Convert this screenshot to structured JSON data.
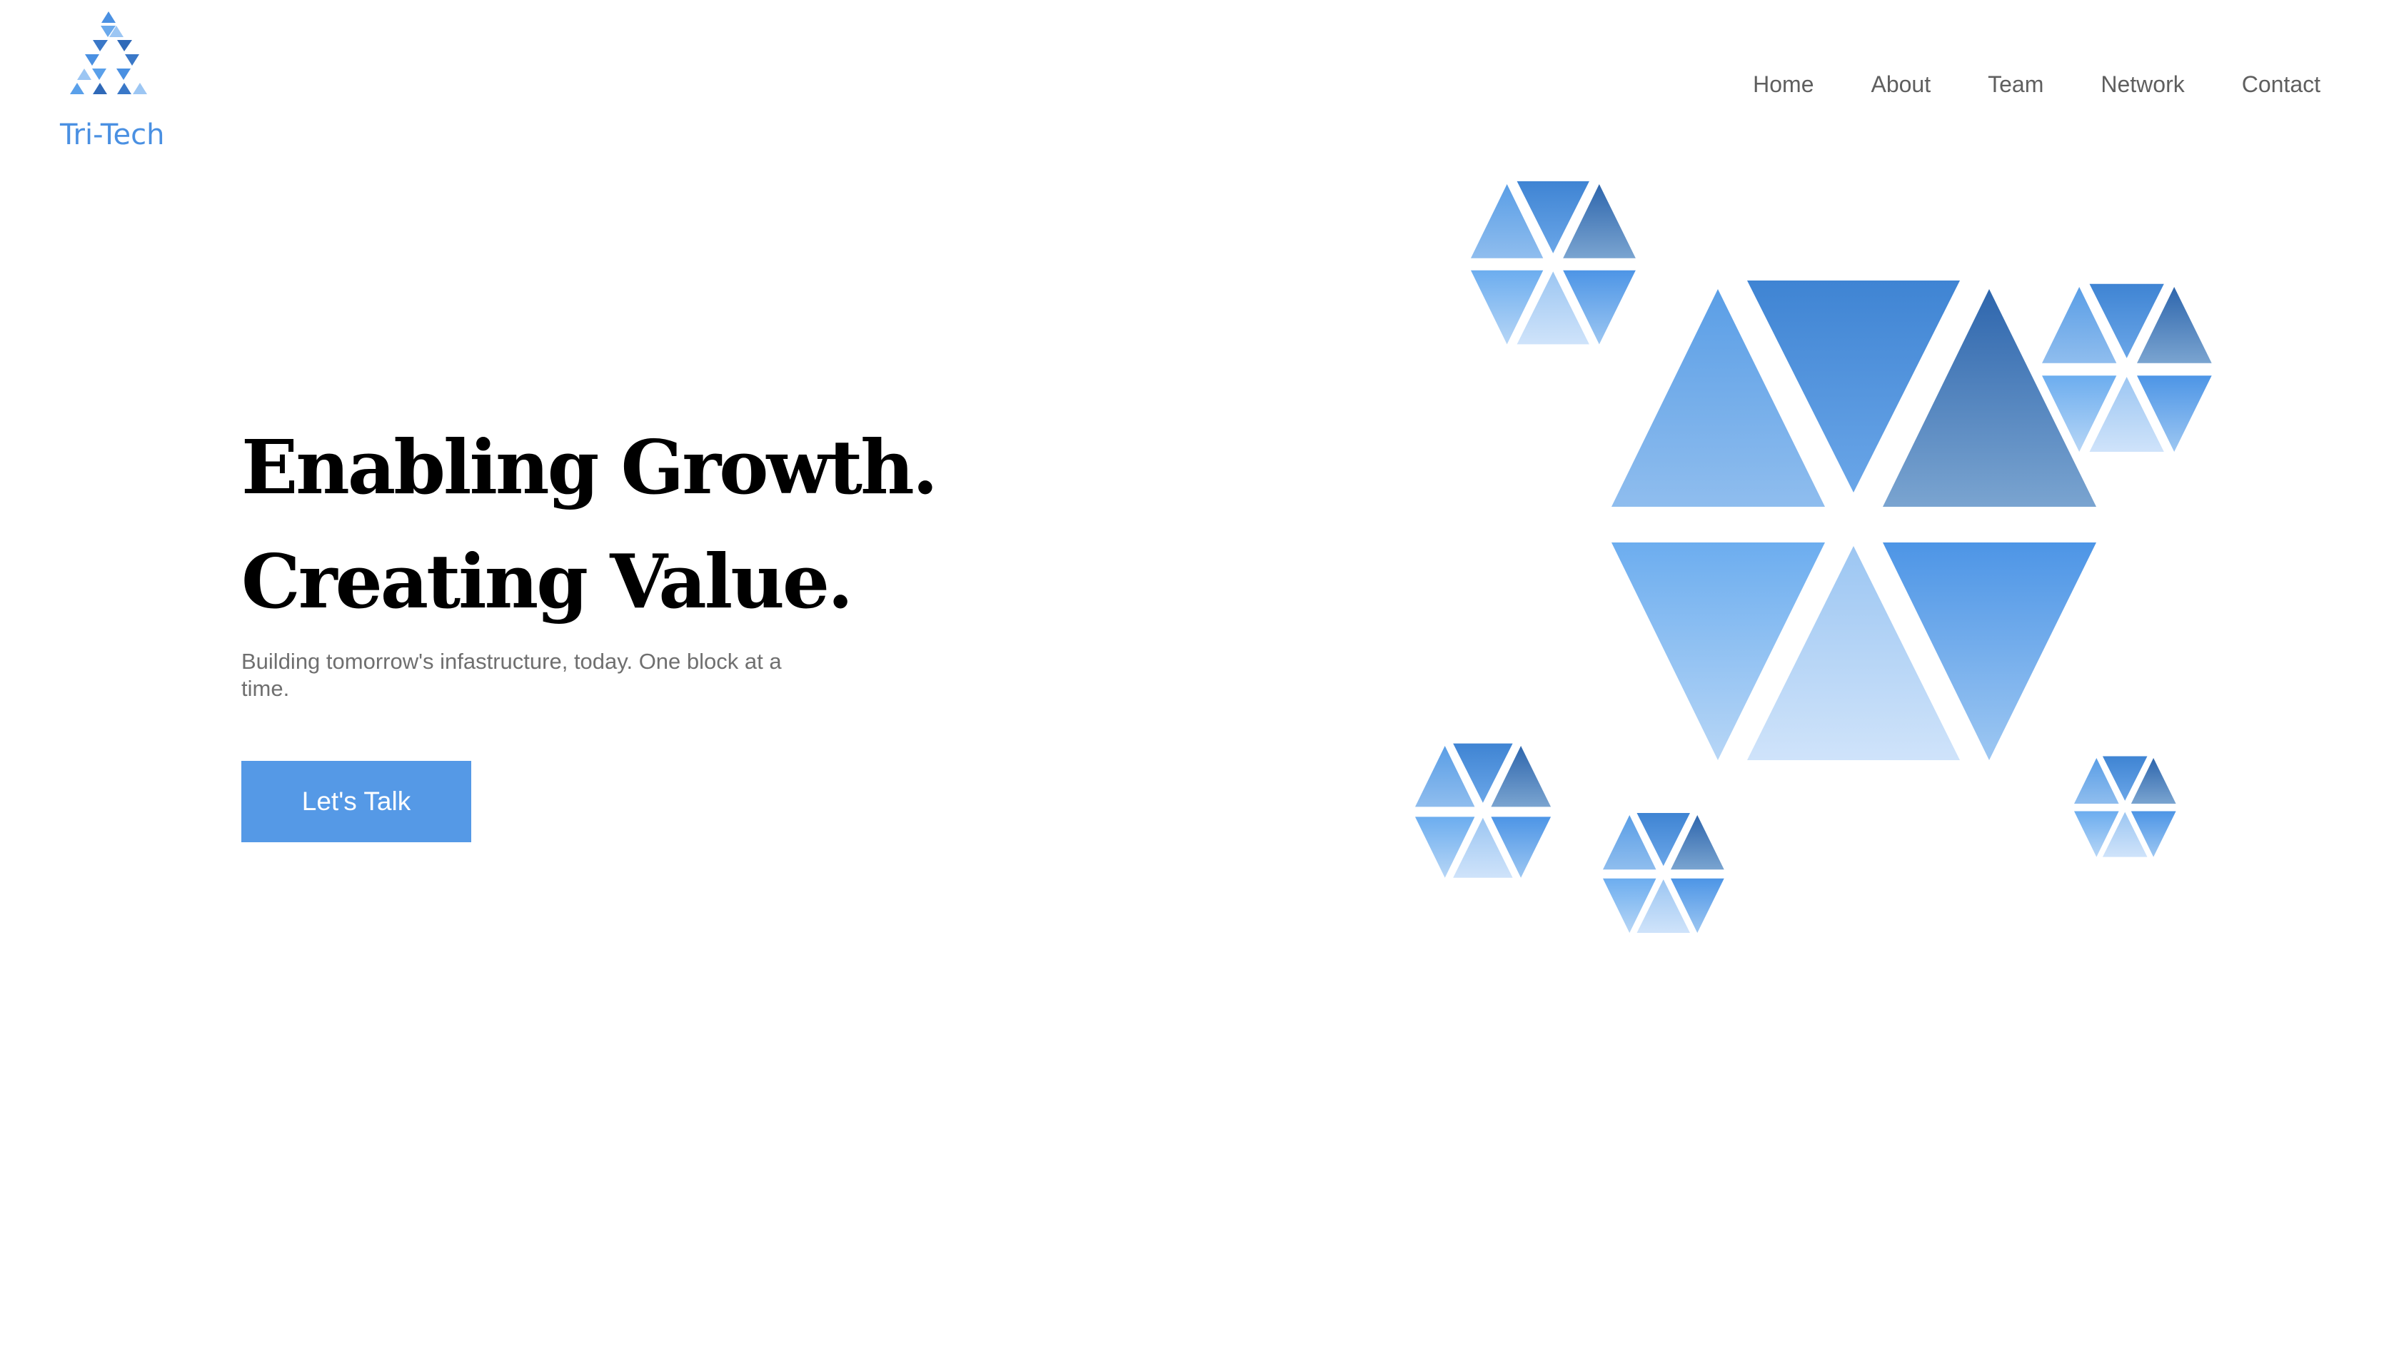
{
  "brand": {
    "name": "Tri-Tech",
    "accent": "#4a90e2"
  },
  "nav": {
    "items": [
      {
        "label": "Home"
      },
      {
        "label": "About"
      },
      {
        "label": "Team"
      },
      {
        "label": "Network"
      },
      {
        "label": "Contact"
      }
    ]
  },
  "hero": {
    "title_line1": "Enabling Growth.",
    "title_line2": "Creating Value.",
    "subtitle": "Building tomorrow's infastructure, today. One block at a time.",
    "cta_label": "Let's Talk",
    "cta_color": "#5599e6"
  },
  "illustration": {
    "icon": "triangle-hexagon-cluster-icon"
  }
}
